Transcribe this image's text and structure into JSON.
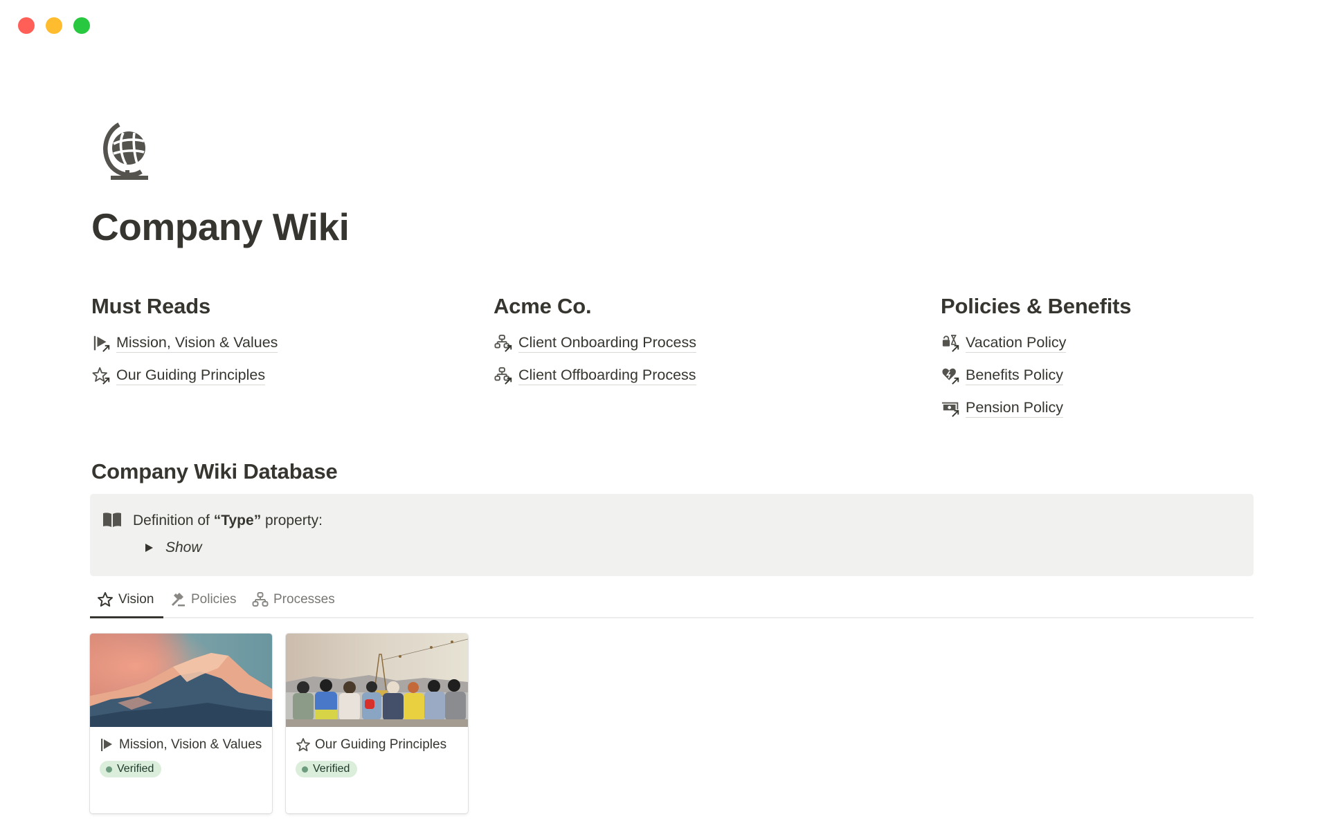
{
  "window": {
    "controls": [
      {
        "name": "close",
        "color": "#ff5f57"
      },
      {
        "name": "minimize",
        "color": "#febc2e"
      },
      {
        "name": "zoom",
        "color": "#28c840"
      }
    ]
  },
  "page": {
    "icon": "globe-icon",
    "title": "Company Wiki"
  },
  "sections": [
    {
      "heading": "Must Reads",
      "links": [
        {
          "label": "Mission, Vision & Values",
          "icon": "flag-icon"
        },
        {
          "label": "Our Guiding Principles",
          "icon": "star-icon"
        }
      ]
    },
    {
      "heading": "Acme Co.",
      "links": [
        {
          "label": "Client Onboarding Process",
          "icon": "flowchart-icon"
        },
        {
          "label": "Client Offboarding Process",
          "icon": "flowchart-icon"
        }
      ]
    },
    {
      "heading": "Policies & Benefits",
      "links": [
        {
          "label": "Vacation Policy",
          "icon": "lock-hourglass-icon"
        },
        {
          "label": "Benefits Policy",
          "icon": "heart-bolt-icon"
        },
        {
          "label": "Pension Policy",
          "icon": "money-icon"
        }
      ]
    }
  ],
  "database": {
    "title": "Company Wiki Database",
    "callout": {
      "icon": "book-icon",
      "text_before": "Definition of ",
      "text_bold": "“Type”",
      "text_after": " property:",
      "toggle_label": "Show"
    },
    "tabs": [
      {
        "label": "Vision",
        "icon": "star-icon",
        "active": true
      },
      {
        "label": "Policies",
        "icon": "gavel-icon",
        "active": false
      },
      {
        "label": "Processes",
        "icon": "flowchart-icon",
        "active": false
      }
    ],
    "cards": [
      {
        "title": "Mission, Vision & Values",
        "icon": "flag-icon",
        "cover": "mountain-sunset-image",
        "status": "Verified"
      },
      {
        "title": "Our Guiding Principles",
        "icon": "star-icon",
        "cover": "group-of-friends-image",
        "status": "Verified"
      }
    ]
  },
  "colors": {
    "text": "#37352f",
    "muted": "#787774",
    "callout_bg": "#f1f1ef",
    "badge_bg": "#dbeddb",
    "badge_dot": "#6c9b7d"
  }
}
